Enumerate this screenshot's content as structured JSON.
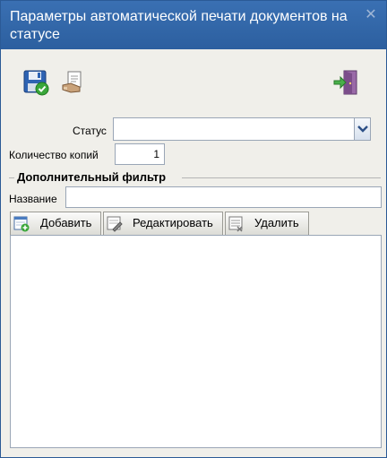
{
  "window": {
    "title": "Параметры автоматической печати документов на статусе",
    "close_glyph": "✕"
  },
  "toolbar": {
    "save_icon": "save-disk-check-icon",
    "print_icon": "print-document-icon",
    "exit_icon": "exit-door-icon"
  },
  "form": {
    "status_label": "Статус",
    "status_value": "",
    "copies_label": "Количество копий",
    "copies_value": "1"
  },
  "filter": {
    "group_title": "Дополнительный фильтр",
    "name_label": "Название",
    "name_value": "",
    "add_label": "Добавить",
    "edit_label": "Редактировать",
    "delete_label": "Удалить",
    "items": []
  },
  "colors": {
    "titlebar": "#2f65a8",
    "window_bg": "#f0efea",
    "border": "#9aa6b6"
  }
}
